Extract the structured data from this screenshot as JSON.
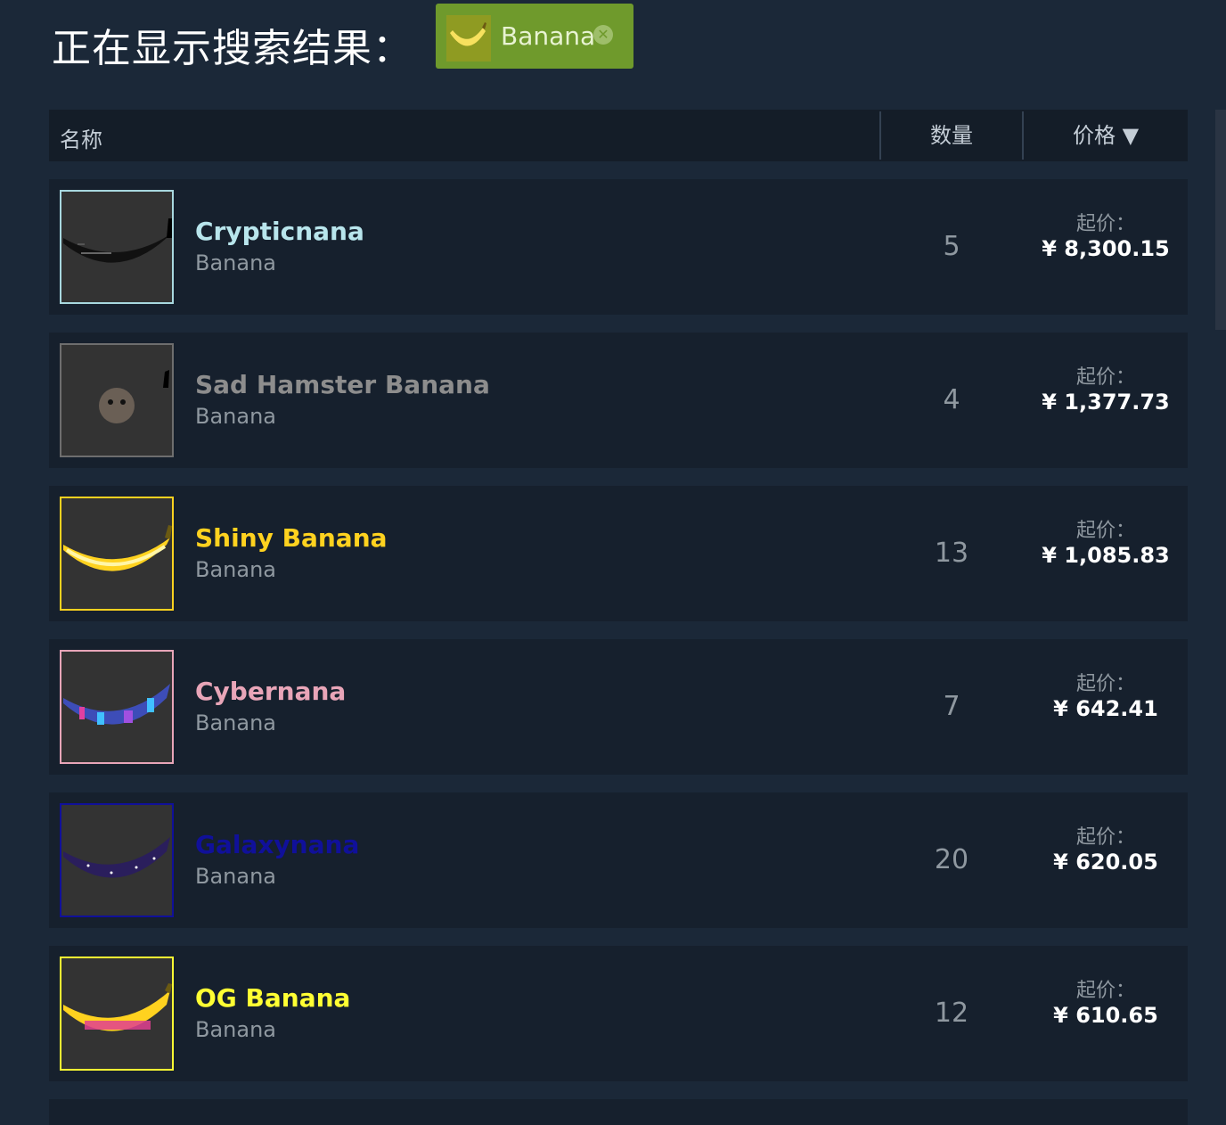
{
  "heading": "正在显示搜索结果：",
  "filter": {
    "label": "Banana",
    "remove_icon": "✕"
  },
  "table_header": {
    "name": "名称",
    "quantity": "数量",
    "price": "价格 ▼"
  },
  "rows": [
    {
      "name": "Crypticnana",
      "game": "Banana",
      "quantity": "5",
      "price_label": "起价：",
      "price": "¥ 8,300.15",
      "name_color": "#b8e5ec"
    },
    {
      "name": "Sad Hamster Banana",
      "game": "Banana",
      "quantity": "4",
      "price_label": "起价：",
      "price": "¥ 1,377.73",
      "name_color": "#8d8d8d"
    },
    {
      "name": "Shiny Banana",
      "game": "Banana",
      "quantity": "13",
      "price_label": "起价：",
      "price": "¥ 1,085.83",
      "name_color": "#ffd21f"
    },
    {
      "name": "Cybernana",
      "game": "Banana",
      "quantity": "7",
      "price_label": "起价：",
      "price": "¥ 642.41",
      "name_color": "#e8a5b8"
    },
    {
      "name": "Galaxynana",
      "game": "Banana",
      "quantity": "20",
      "price_label": "起价：",
      "price": "¥ 620.05",
      "name_color": "#10109a"
    },
    {
      "name": "OG Banana",
      "game": "Banana",
      "quantity": "12",
      "price_label": "起价：",
      "price": "¥ 610.65",
      "name_color": "#ffff33"
    }
  ]
}
